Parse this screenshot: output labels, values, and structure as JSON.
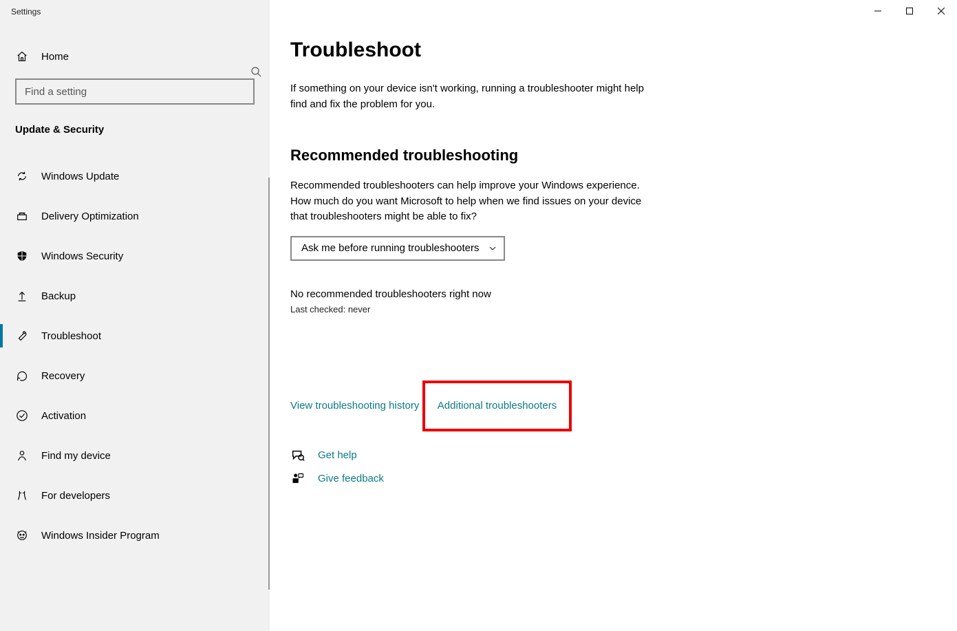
{
  "app": {
    "title": "Settings"
  },
  "home": {
    "label": "Home"
  },
  "search": {
    "placeholder": "Find a setting"
  },
  "section": {
    "title": "Update & Security"
  },
  "sidebar": {
    "items": [
      {
        "label": "Windows Update"
      },
      {
        "label": "Delivery Optimization"
      },
      {
        "label": "Windows Security"
      },
      {
        "label": "Backup"
      },
      {
        "label": "Troubleshoot"
      },
      {
        "label": "Recovery"
      },
      {
        "label": "Activation"
      },
      {
        "label": "Find my device"
      },
      {
        "label": "For developers"
      },
      {
        "label": "Windows Insider Program"
      }
    ]
  },
  "main": {
    "title": "Troubleshoot",
    "intro": "If something on your device isn't working, running a troubleshooter might help find and fix the problem for you.",
    "section_title": "Recommended troubleshooting",
    "section_body": "Recommended troubleshooters can help improve your Windows experience. How much do you want Microsoft to help when we find issues on your device that troubleshooters might be able to fix?",
    "dropdown_value": "Ask me before running troubleshooters",
    "status": "No recommended troubleshooters right now",
    "status_sub": "Last checked: never",
    "links": {
      "history": "View troubleshooting history",
      "additional": "Additional troubleshooters",
      "help": "Get help",
      "feedback": "Give feedback"
    }
  }
}
